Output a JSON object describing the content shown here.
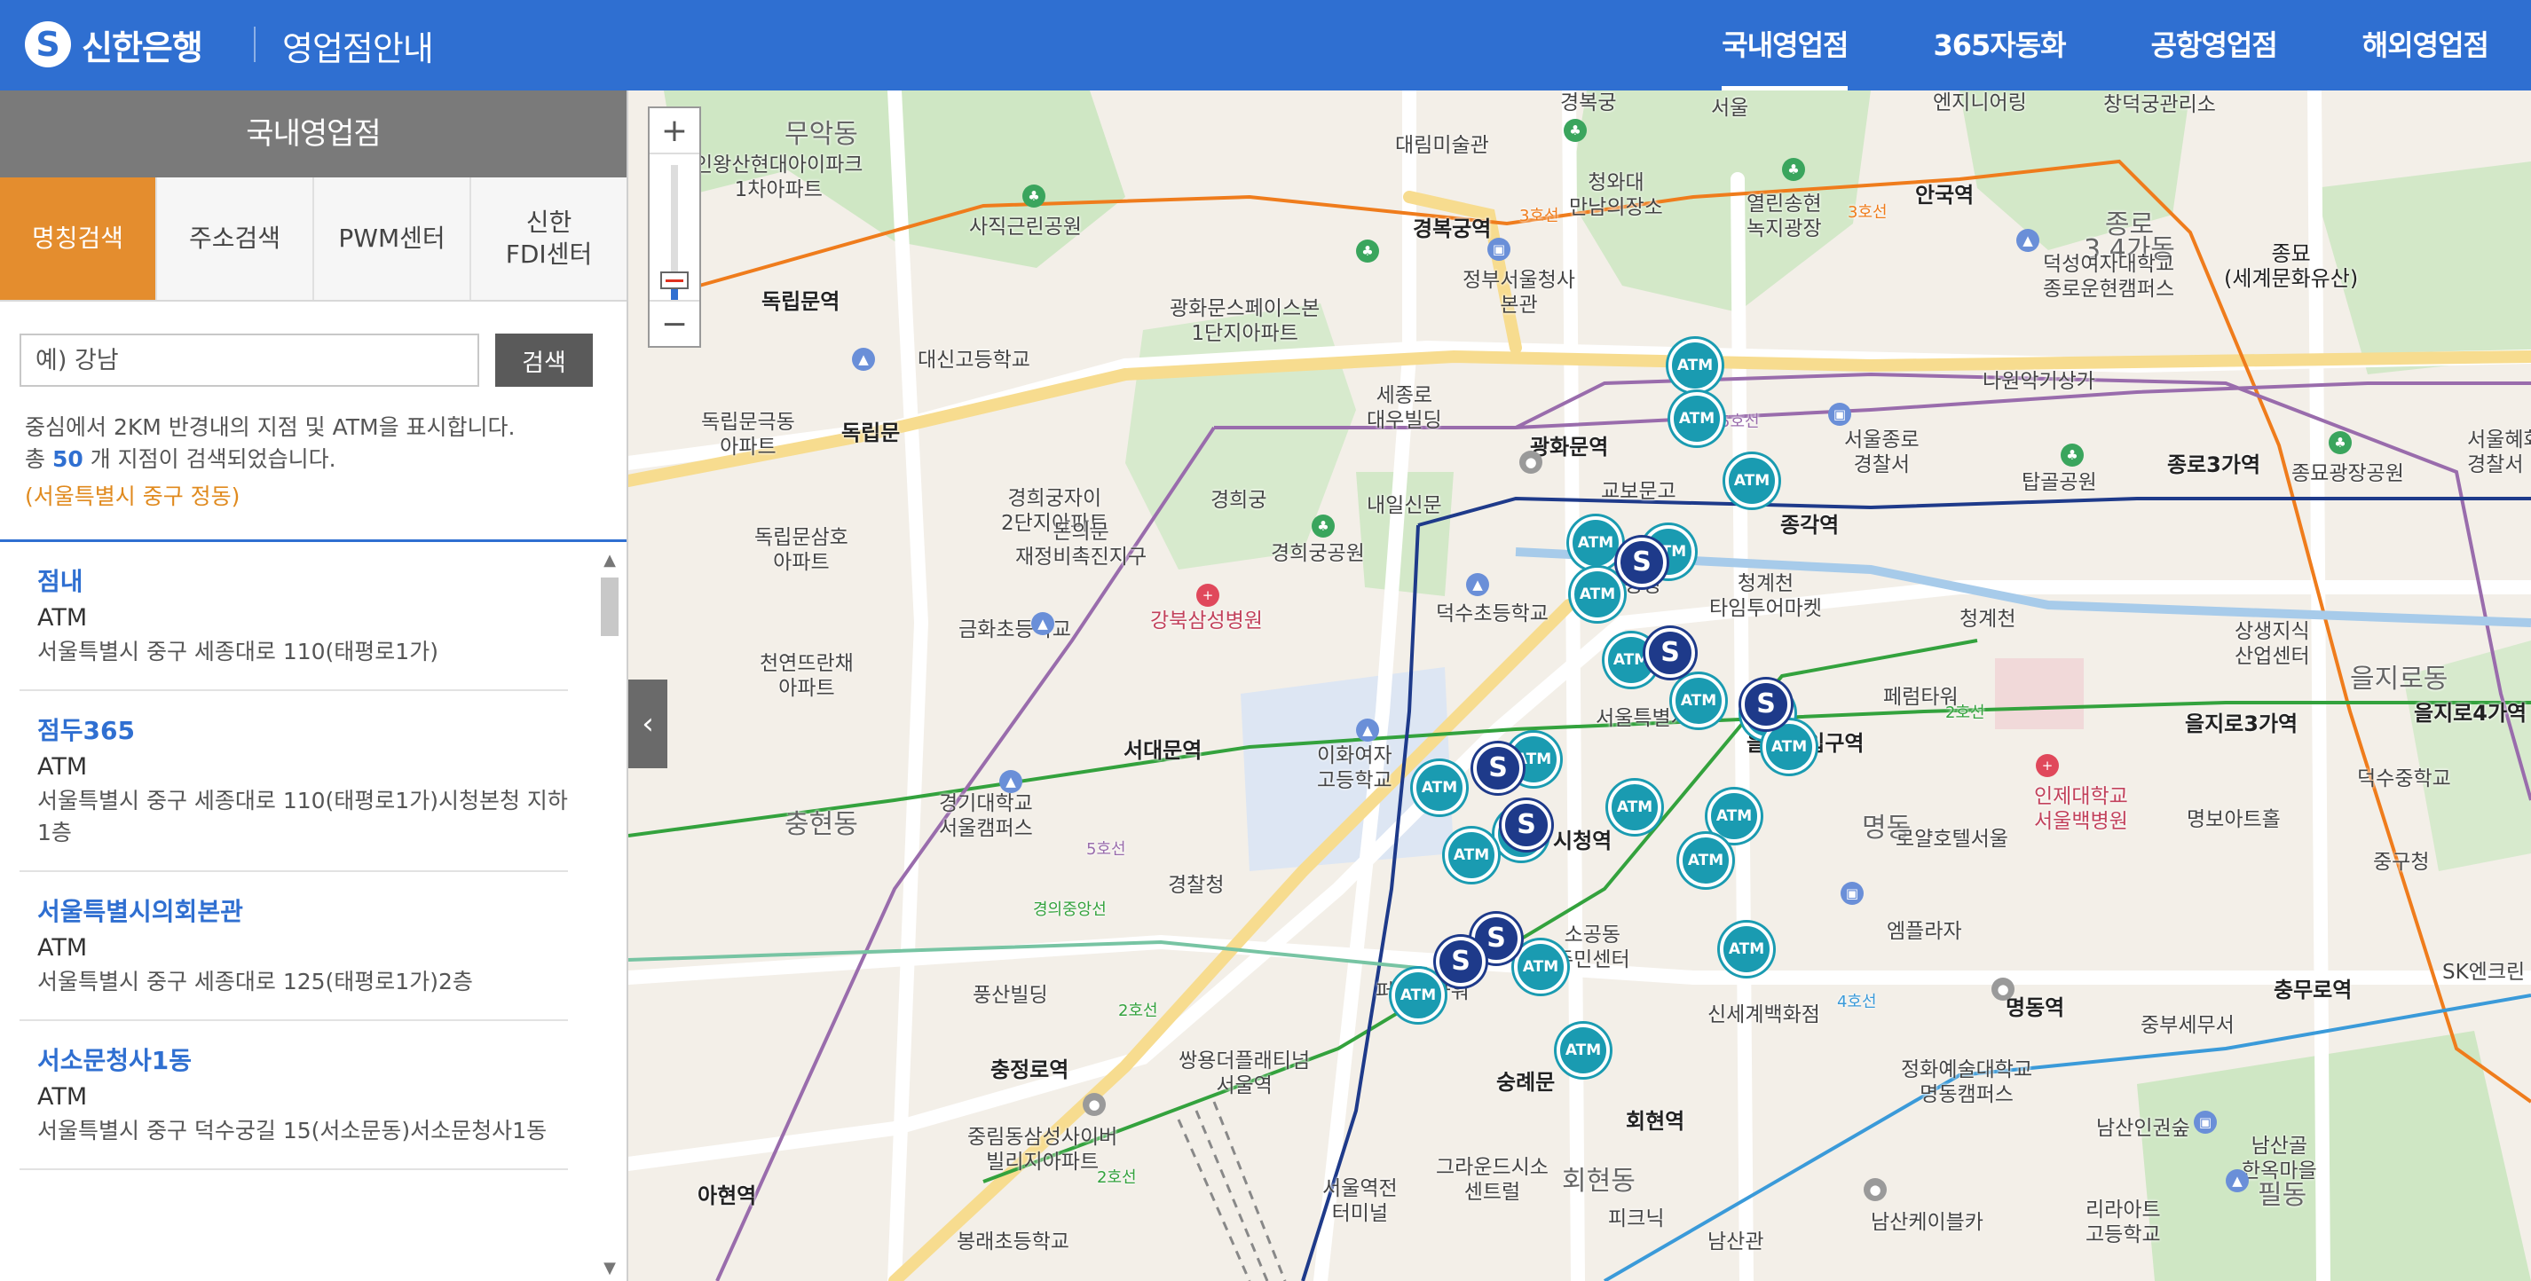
{
  "header": {
    "logo_mark": "S",
    "logo_text": "신한은행",
    "title": "영업점안내",
    "nav": [
      "국내영업점",
      "365자동화",
      "공항영업점",
      "해외영업점"
    ]
  },
  "sidebar": {
    "title": "국내영업점",
    "tabs": [
      "명칭검색",
      "주소검색",
      "PWM센터",
      "신한\nFDI센터"
    ],
    "search_placeholder": "예) 강남",
    "search_button": "검색",
    "info_line1": "중심에서 2KM 반경내의 지점 및 ATM을 표시합니다.",
    "info_prefix": "총",
    "info_count": "50",
    "info_suffix": "개 지점이 검색되었습니다.",
    "location": "(서울특별시 중구 정동)",
    "results": [
      {
        "name": "점내",
        "type": "ATM",
        "address": "서울특별시 중구 세종대로 110(태평로1가)"
      },
      {
        "name": "점두365",
        "type": "ATM",
        "address": "서울특별시 중구 세종대로 110(태평로1가)시청본청 지하1층"
      },
      {
        "name": "서울특별시의회본관",
        "type": "ATM",
        "address": "서울특별시 중구 세종대로 125(태평로1가)2층"
      },
      {
        "name": "서소문청사1동",
        "type": "ATM",
        "address": "서울특별시 중구 덕수궁길 15(서소문동)서소문청사1동"
      }
    ]
  },
  "map": {
    "atm_label": "ATM",
    "branch_label": "S",
    "zoom_in": "+",
    "zoom_out": "−",
    "collapse": "‹",
    "labels": [
      {
        "text": "경복궁",
        "cls": ""
      },
      {
        "text": "무악동",
        "cls": "big"
      },
      {
        "text": "서울",
        "cls": ""
      },
      {
        "text": "엔지니어링",
        "cls": ""
      },
      {
        "text": "창덕궁관리소",
        "cls": ""
      },
      {
        "text": "인왕산현대아이파크\n1차아파트",
        "cls": ""
      },
      {
        "text": "대림미술관",
        "cls": ""
      },
      {
        "text": "청와대\n만남의장소",
        "cls": ""
      },
      {
        "text": "열린송현\n녹지광장",
        "cls": ""
      },
      {
        "text": "안국역",
        "cls": "station"
      },
      {
        "text": "종로\n3.4가동",
        "cls": "big"
      },
      {
        "text": "종묘\n(세계문화유산)",
        "cls": "station"
      },
      {
        "text": "사직근린공원",
        "cls": ""
      },
      {
        "text": "경복궁역",
        "cls": "station"
      },
      {
        "text": "독립문역",
        "cls": "station"
      },
      {
        "text": "정부서울청사\n본관",
        "cls": ""
      },
      {
        "text": "광화문스페이스본\n1단지아파트",
        "cls": ""
      },
      {
        "text": "덕성여자대학교\n종로운현캠퍼스",
        "cls": ""
      },
      {
        "text": "대신고등학교",
        "cls": ""
      },
      {
        "text": "나원악기상가",
        "cls": ""
      },
      {
        "text": "세종로\n대우빌딩",
        "cls": ""
      },
      {
        "text": "독립문극동\n아파트",
        "cls": ""
      },
      {
        "text": "독립문",
        "cls": "station"
      },
      {
        "text": "광화문역",
        "cls": "station"
      },
      {
        "text": "서울종로\n경찰서",
        "cls": ""
      },
      {
        "text": "탑골공원",
        "cls": ""
      },
      {
        "text": "종로3가역",
        "cls": "station"
      },
      {
        "text": "종묘광장공원",
        "cls": ""
      },
      {
        "text": "경희궁자이\n2단지아파트",
        "cls": ""
      },
      {
        "text": "경희궁",
        "cls": ""
      },
      {
        "text": "교보문고",
        "cls": ""
      },
      {
        "text": "종각역",
        "cls": "station"
      },
      {
        "text": "돈의문\n재정비촉진지구",
        "cls": ""
      },
      {
        "text": "내일신문",
        "cls": ""
      },
      {
        "text": "경희궁공원",
        "cls": ""
      },
      {
        "text": "청계광장",
        "cls": ""
      },
      {
        "text": "청계천\n타임투어마켓",
        "cls": ""
      },
      {
        "text": "독립문삼호\n아파트",
        "cls": ""
      },
      {
        "text": "금화초등학교",
        "cls": ""
      },
      {
        "text": "강북삼성병원",
        "cls": "hospital"
      },
      {
        "text": "덕수초등학교",
        "cls": ""
      },
      {
        "text": "청계천",
        "cls": ""
      },
      {
        "text": "상생지식\n산업센터",
        "cls": ""
      },
      {
        "text": "을지로동",
        "cls": "big"
      },
      {
        "text": "천연뜨란채\n아파트",
        "cls": ""
      },
      {
        "text": "페럼타워",
        "cls": ""
      },
      {
        "text": "을지로3가역",
        "cls": "station"
      },
      {
        "text": "을지로4가역",
        "cls": "station"
      },
      {
        "text": "서울특별시청",
        "cls": ""
      },
      {
        "text": "을지로입구역",
        "cls": "station"
      },
      {
        "text": "서대문역",
        "cls": "station"
      },
      {
        "text": "이화여자\n고등학교",
        "cls": ""
      },
      {
        "text": "인제대학교\n서울백병원",
        "cls": "hospital"
      },
      {
        "text": "덕수중학교",
        "cls": ""
      },
      {
        "text": "충현동",
        "cls": "big"
      },
      {
        "text": "경기대학교\n서울캠퍼스",
        "cls": ""
      },
      {
        "text": "시청역",
        "cls": "station"
      },
      {
        "text": "명동",
        "cls": "big"
      },
      {
        "text": "로얄호텔서울",
        "cls": ""
      },
      {
        "text": "명보아트홀",
        "cls": ""
      },
      {
        "text": "경찰청",
        "cls": ""
      },
      {
        "text": "소공동\n주민센터",
        "cls": ""
      },
      {
        "text": "엠플라자",
        "cls": ""
      },
      {
        "text": "중구청",
        "cls": ""
      },
      {
        "text": "풍산빌딩",
        "cls": ""
      },
      {
        "text": "퍼시픽타워",
        "cls": ""
      },
      {
        "text": "명동역",
        "cls": "station"
      },
      {
        "text": "충무로역",
        "cls": "station"
      },
      {
        "text": "SK엔크린",
        "cls": ""
      },
      {
        "text": "신세계백화점",
        "cls": ""
      },
      {
        "text": "중부세무서",
        "cls": ""
      },
      {
        "text": "충정로역",
        "cls": "station"
      },
      {
        "text": "쌍용더플래티넘\n서울역",
        "cls": ""
      },
      {
        "text": "숭례문",
        "cls": "station"
      },
      {
        "text": "정화예술대학교\n명동캠퍼스",
        "cls": ""
      },
      {
        "text": "회현역",
        "cls": "station"
      },
      {
        "text": "남산인권숲",
        "cls": ""
      },
      {
        "text": "남산골\n한옥마을",
        "cls": ""
      },
      {
        "text": "중림동삼성사이버\n빌리지아파트",
        "cls": ""
      },
      {
        "text": "아현역",
        "cls": "station"
      },
      {
        "text": "그라운드시소\n센트럴",
        "cls": ""
      },
      {
        "text": "회현동",
        "cls": "big"
      },
      {
        "text": "서울역전\n터미널",
        "cls": ""
      },
      {
        "text": "피크닉",
        "cls": ""
      },
      {
        "text": "남산케이블카",
        "cls": ""
      },
      {
        "text": "리라아트\n고등학교",
        "cls": ""
      },
      {
        "text": "필동",
        "cls": "big"
      },
      {
        "text": "봉래초등학교",
        "cls": ""
      },
      {
        "text": "남산관",
        "cls": ""
      },
      {
        "text": "서울혜화\n경찰서",
        "cls": ""
      }
    ],
    "line_labels": [
      "3호선",
      "3호선",
      "5호선",
      "2호선",
      "4호선",
      "2호선",
      "경의중앙선",
      "2호선",
      "5호선"
    ]
  }
}
